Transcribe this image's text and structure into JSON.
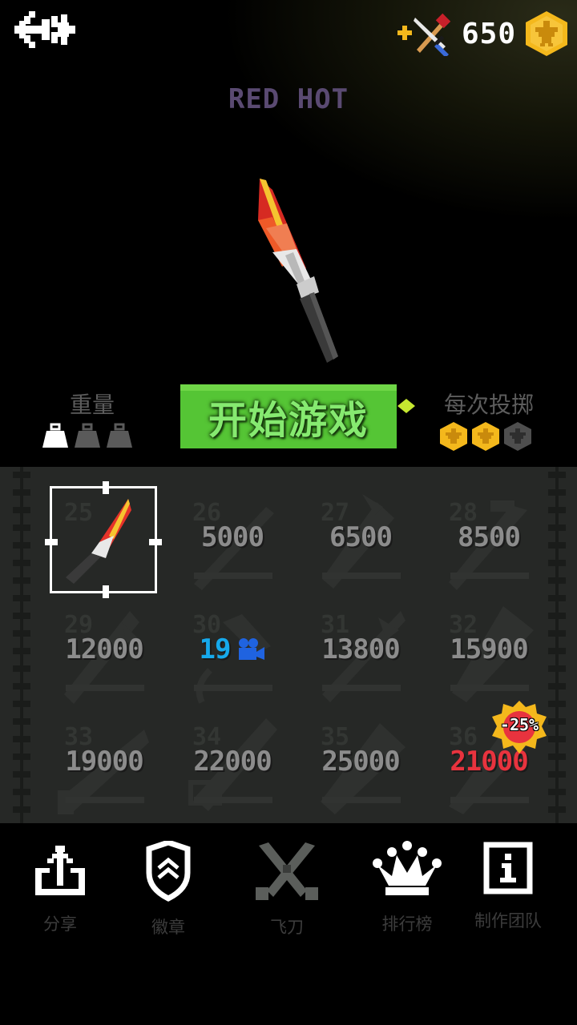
{
  "header": {
    "coins": "650"
  },
  "knife": {
    "name": "RED HOT"
  },
  "stats": {
    "weight_label": "重量",
    "weight_level": 1,
    "weight_max": 3,
    "throw_label": "每次投掷",
    "throw_cost": 2,
    "throw_max": 3
  },
  "start_button": {
    "label": "开始游戏"
  },
  "grid": {
    "cells": [
      {
        "num": "25",
        "price": "",
        "state": "selected"
      },
      {
        "num": "26",
        "price": "5000",
        "state": "locked"
      },
      {
        "num": "27",
        "price": "6500",
        "state": "locked"
      },
      {
        "num": "28",
        "price": "8500",
        "state": "locked"
      },
      {
        "num": "29",
        "price": "12000",
        "state": "locked"
      },
      {
        "num": "30",
        "price": "19",
        "state": "video"
      },
      {
        "num": "31",
        "price": "13800",
        "state": "locked"
      },
      {
        "num": "32",
        "price": "15900",
        "state": "locked"
      },
      {
        "num": "33",
        "price": "19000",
        "state": "locked"
      },
      {
        "num": "34",
        "price": "22000",
        "state": "locked"
      },
      {
        "num": "35",
        "price": "25000",
        "state": "locked"
      },
      {
        "num": "36",
        "price": "21000",
        "state": "sale",
        "discount": "-25%"
      }
    ]
  },
  "nav": {
    "items": [
      {
        "label": "分享",
        "icon": "share-icon"
      },
      {
        "label": "徽章",
        "icon": "badge-icon"
      },
      {
        "label": "飞刀",
        "icon": "crossed-knives-icon"
      },
      {
        "label": "排行榜",
        "icon": "crown-icon"
      },
      {
        "label": "制作团队",
        "icon": "info-icon"
      }
    ]
  },
  "colors": {
    "accent_green": "#55c535",
    "gold": "#f4b81c",
    "sale_red": "#e8333e",
    "video_blue": "#16a9ec"
  }
}
